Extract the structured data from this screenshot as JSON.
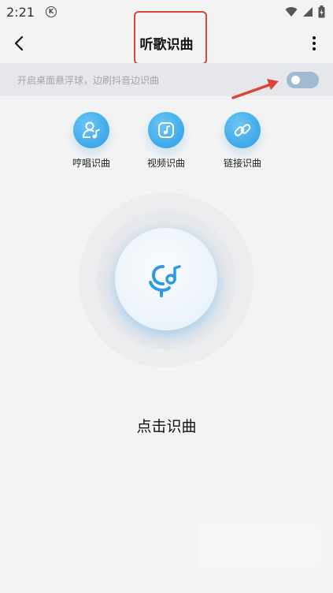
{
  "status_bar": {
    "time": "2:21",
    "badge": "K",
    "icons": [
      "wifi-icon",
      "signal-icon",
      "battery-icon"
    ]
  },
  "header": {
    "title": "听歌识曲",
    "back_icon": "back-arrow-icon",
    "more_icon": "more-vertical-icon"
  },
  "floating_ball": {
    "text": "开启桌面悬浮球，边刷抖音边识曲",
    "enabled": false
  },
  "modes": [
    {
      "label": "哼唱识曲",
      "icon": "humming-icon"
    },
    {
      "label": "视频识曲",
      "icon": "video-music-icon"
    },
    {
      "label": "链接识曲",
      "icon": "link-icon"
    }
  ],
  "recognize": {
    "icon": "mic-music-icon",
    "label": "点击识曲"
  },
  "colors": {
    "accent": "#2b9be4",
    "annotation": "#d9453a",
    "toggle_track": "#9fbad1"
  }
}
